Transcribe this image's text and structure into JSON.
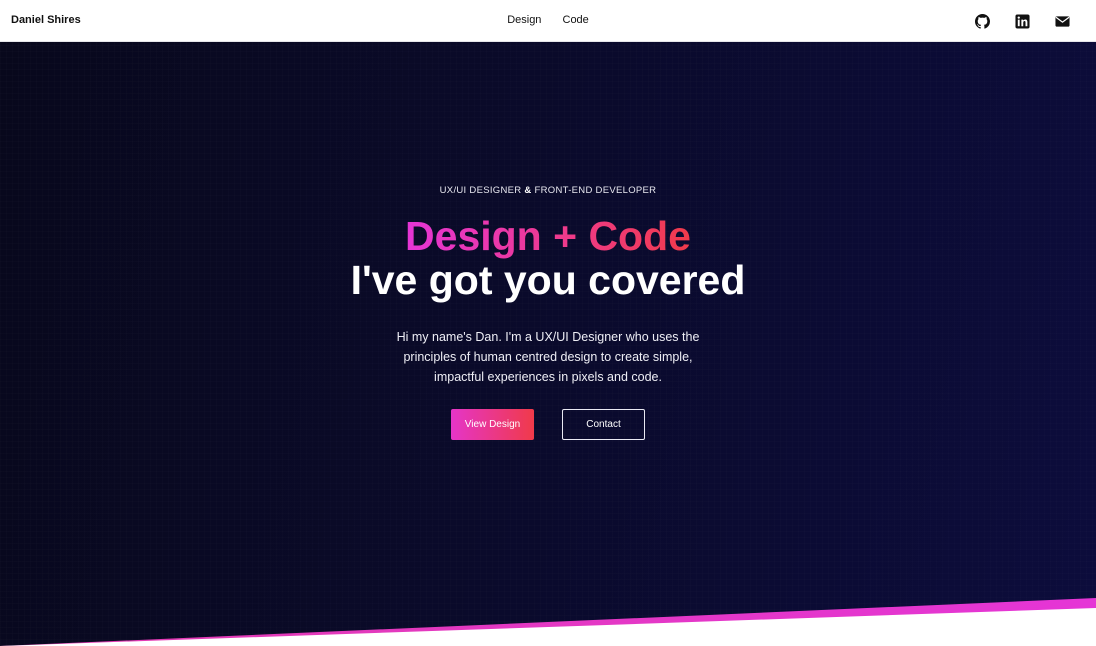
{
  "header": {
    "brand": "Daniel Shires",
    "nav": [
      {
        "label": "Design"
      },
      {
        "label": "Code"
      }
    ],
    "social_icons": [
      "github-icon",
      "linkedin-icon",
      "email-icon"
    ]
  },
  "hero": {
    "eyebrow_part1": "UX/UI DESIGNER ",
    "eyebrow_amp": "&",
    "eyebrow_part2": " FRONT-END DEVELOPER",
    "headline_gradient": "Design + Code",
    "headline_white": "I've got you covered",
    "intro": "Hi my name's Dan. I'm a UX/UI Designer who uses the principles of human centred design to create simple, impactful experiences in pixels and code.",
    "primary_button": "View Design",
    "secondary_button": "Contact"
  },
  "colors": {
    "hero_background": "#0a0a2a",
    "accent_pink": "#e535d6",
    "accent_red": "#f03a4a"
  }
}
